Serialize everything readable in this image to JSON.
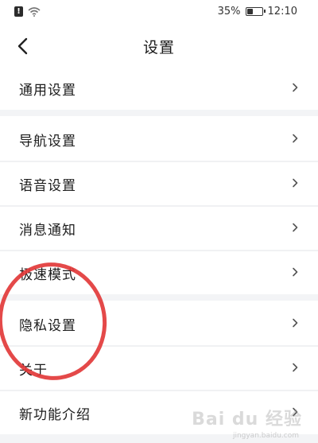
{
  "status_bar": {
    "battery_percent_text": "35%",
    "battery_level": 0.35,
    "time": "12:10"
  },
  "header": {
    "title": "设置",
    "back_icon": "chevron-left-icon"
  },
  "groups": [
    {
      "items": [
        {
          "label": "通用设置"
        }
      ]
    },
    {
      "items": [
        {
          "label": "导航设置"
        },
        {
          "label": "语音设置"
        },
        {
          "label": "消息通知"
        },
        {
          "label": "极速模式"
        }
      ]
    },
    {
      "items": [
        {
          "label": "隐私设置"
        },
        {
          "label": "关于"
        },
        {
          "label": "新功能介绍"
        }
      ]
    }
  ],
  "annotation": {
    "color": "#e23a3a",
    "highlight_target": "隐私设置"
  },
  "watermark": {
    "text": "Bai du 经验",
    "subtext": "jingyan.baidu.com"
  },
  "colors": {
    "background": "#f3f4f6",
    "row_background": "#ffffff",
    "text": "#1c1c1c"
  }
}
